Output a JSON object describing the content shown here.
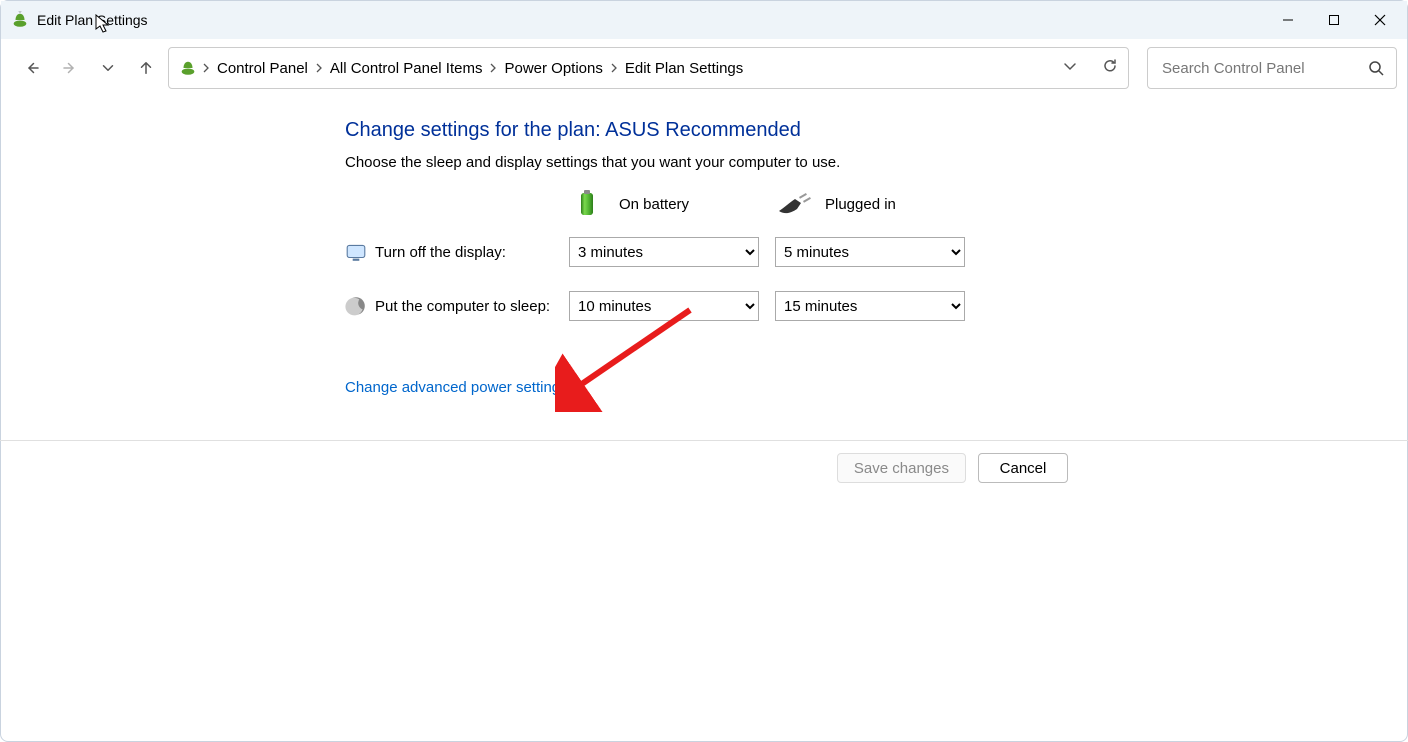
{
  "window": {
    "title": "Edit Plan Settings"
  },
  "breadcrumb": {
    "items": [
      "Control Panel",
      "All Control Panel Items",
      "Power Options",
      "Edit Plan Settings"
    ]
  },
  "search": {
    "placeholder": "Search Control Panel"
  },
  "page": {
    "heading": "Change settings for the plan: ASUS Recommended",
    "description": "Choose the sleep and display settings that you want your computer to use."
  },
  "columns": {
    "battery": "On battery",
    "plugged": "Plugged in"
  },
  "settings": {
    "display": {
      "label": "Turn off the display:",
      "battery": "3 minutes",
      "plugged": "5 minutes"
    },
    "sleep": {
      "label": "Put the computer to sleep:",
      "battery": "10 minutes",
      "plugged": "15 minutes"
    }
  },
  "advanced_link": "Change advanced power settings",
  "buttons": {
    "save": "Save changes",
    "cancel": "Cancel"
  }
}
